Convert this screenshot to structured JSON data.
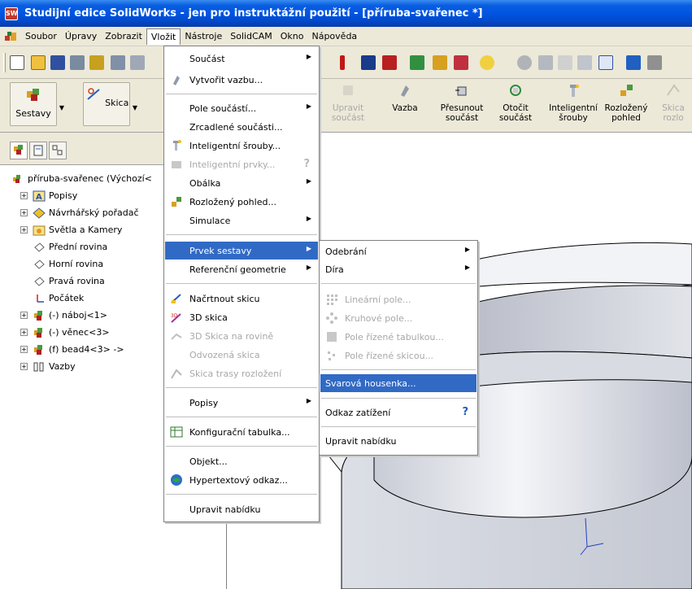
{
  "window": {
    "title": "Studijní edice SolidWorks - jen pro instruktážní použití - [příruba-svařenec *]",
    "app_icon": "SW"
  },
  "menubar": {
    "items": [
      "Soubor",
      "Úpravy",
      "Zobrazit",
      "Vložit",
      "Nástroje",
      "SolidCAM",
      "Okno",
      "Nápověda"
    ],
    "active": "Vložit"
  },
  "commandmanager": {
    "groups": [
      {
        "label": "Sestavy"
      },
      {
        "label": "Skica"
      }
    ],
    "buttons": [
      {
        "line1": "Upravit",
        "line2": "součást",
        "enabled": false
      },
      {
        "line1": "Vazba",
        "line2": "",
        "enabled": true
      },
      {
        "line1": "Přesunout",
        "line2": "součást",
        "enabled": true
      },
      {
        "line1": "Otočit",
        "line2": "součást",
        "enabled": true
      },
      {
        "line1": "Inteligentní",
        "line2": "šrouby",
        "enabled": true
      },
      {
        "line1": "Rozložený",
        "line2": "pohled",
        "enabled": true
      },
      {
        "line1": "Skica",
        "line2": "rozlo",
        "enabled": false
      }
    ]
  },
  "tree": {
    "root": "příruba-svařenec  (Výchozí<",
    "items": [
      {
        "label": "Popisy",
        "icon": "annotations-icon",
        "expandable": true
      },
      {
        "label": "Návrhářský pořadač",
        "icon": "design-binder-icon",
        "expandable": true
      },
      {
        "label": "Světla a Kamery",
        "icon": "lights-cameras-icon",
        "expandable": true
      },
      {
        "label": "Přední rovina",
        "icon": "plane-icon",
        "expandable": false
      },
      {
        "label": "Horní rovina",
        "icon": "plane-icon",
        "expandable": false
      },
      {
        "label": "Pravá rovina",
        "icon": "plane-icon",
        "expandable": false
      },
      {
        "label": "Počátek",
        "icon": "origin-icon",
        "expandable": false
      },
      {
        "label": "(-) náboj<1>",
        "icon": "part-icon",
        "expandable": true
      },
      {
        "label": "(-) věnec<3>",
        "icon": "part-icon",
        "expandable": true
      },
      {
        "label": "(f) bead4<3> ->",
        "icon": "part-icon",
        "expandable": true
      },
      {
        "label": "Vazby",
        "icon": "mates-icon",
        "expandable": true
      }
    ]
  },
  "insert_menu": {
    "items": [
      {
        "label": "Součást",
        "submenu": true,
        "enabled": true,
        "icon": ""
      },
      {
        "label": "Vytvořit vazbu...",
        "submenu": false,
        "enabled": true,
        "icon": "mate-icon"
      },
      {
        "sep": true
      },
      {
        "label": "Pole součástí...",
        "submenu": true,
        "enabled": true,
        "icon": ""
      },
      {
        "label": "Zrcadlené součásti...",
        "submenu": false,
        "enabled": true,
        "icon": ""
      },
      {
        "label": "Inteligentní šrouby...",
        "submenu": false,
        "enabled": true,
        "icon": "smart-fastener-icon"
      },
      {
        "label": "Inteligentní prvky...",
        "submenu": false,
        "enabled": false,
        "icon": "smart-feature-icon",
        "help": true
      },
      {
        "label": "Obálka",
        "submenu": true,
        "enabled": true,
        "icon": ""
      },
      {
        "label": "Rozložený pohled...",
        "submenu": false,
        "enabled": true,
        "icon": "exploded-view-icon"
      },
      {
        "label": "Simulace",
        "submenu": true,
        "enabled": true,
        "icon": ""
      },
      {
        "sep": true
      },
      {
        "label": "Prvek sestavy",
        "submenu": true,
        "enabled": true,
        "highlighted": true,
        "icon": ""
      },
      {
        "label": "Referenční geometrie",
        "submenu": true,
        "enabled": true,
        "icon": ""
      },
      {
        "sep": true
      },
      {
        "label": "Načrtnout skicu",
        "submenu": false,
        "enabled": true,
        "icon": "sketch-icon"
      },
      {
        "label": "3D skica",
        "submenu": false,
        "enabled": true,
        "icon": "3d-sketch-icon"
      },
      {
        "label": "3D Skica na rovině",
        "submenu": false,
        "enabled": false,
        "icon": "3d-sketch-plane-icon"
      },
      {
        "label": "Odvozená skica",
        "submenu": false,
        "enabled": false,
        "icon": ""
      },
      {
        "label": "Skica trasy rozložení",
        "submenu": false,
        "enabled": false,
        "icon": "explode-line-sketch-icon"
      },
      {
        "sep": true
      },
      {
        "label": "Popisy",
        "submenu": true,
        "enabled": true,
        "icon": ""
      },
      {
        "sep": true
      },
      {
        "label": "Konfigurační tabulka...",
        "submenu": false,
        "enabled": true,
        "icon": "design-table-icon"
      },
      {
        "sep": true
      },
      {
        "label": "Objekt...",
        "submenu": false,
        "enabled": true,
        "icon": ""
      },
      {
        "label": "Hypertextový odkaz...",
        "submenu": false,
        "enabled": true,
        "icon": "hyperlink-icon"
      },
      {
        "sep": true
      },
      {
        "label": "Upravit nabídku",
        "submenu": false,
        "enabled": true,
        "icon": ""
      }
    ]
  },
  "feature_submenu": {
    "items": [
      {
        "label": "Odebrání",
        "submenu": true,
        "enabled": true,
        "icon": ""
      },
      {
        "label": "Díra",
        "submenu": true,
        "enabled": true,
        "icon": ""
      },
      {
        "sep": true
      },
      {
        "label": "Lineární pole...",
        "submenu": false,
        "enabled": false,
        "icon": "linear-pattern-icon"
      },
      {
        "label": "Kruhové pole...",
        "submenu": false,
        "enabled": false,
        "icon": "circular-pattern-icon"
      },
      {
        "label": "Pole řízené tabulkou...",
        "submenu": false,
        "enabled": false,
        "icon": "table-pattern-icon"
      },
      {
        "label": "Pole řízené skicou...",
        "submenu": false,
        "enabled": false,
        "icon": "sketch-pattern-icon"
      },
      {
        "sep": true
      },
      {
        "label": "Svarová housenka...",
        "submenu": false,
        "enabled": true,
        "highlighted": true,
        "icon": ""
      },
      {
        "sep": true
      },
      {
        "label": "Odkaz zatížení",
        "submenu": false,
        "enabled": true,
        "icon": "",
        "help": true
      },
      {
        "sep": true
      },
      {
        "label": "Upravit nabídku",
        "submenu": false,
        "enabled": true,
        "icon": ""
      }
    ]
  },
  "colors": {
    "highlight": "#316ac5",
    "titlebar": "#0054e3",
    "chrome": "#ece9d8"
  }
}
